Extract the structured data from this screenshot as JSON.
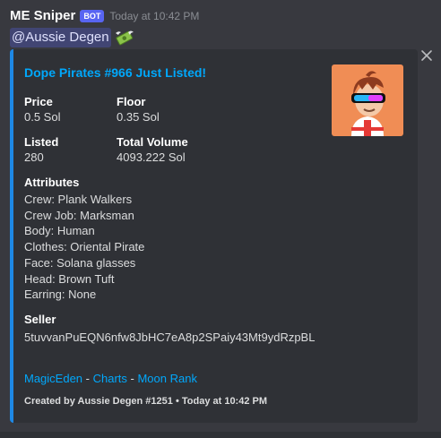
{
  "message": {
    "author": "ME Sniper",
    "bot_tag": "BOT",
    "timestamp": "Today at 10:42 PM",
    "mention": "@Aussie Degen",
    "reaction_icon": "money-with-wings-icon"
  },
  "embed": {
    "accent_color": "#1e88e5",
    "title": "Dope Pirates #966 Just Listed!",
    "thumbnail_icon": "pirate-avatar-icon",
    "fields": {
      "price": {
        "name": "Price",
        "value": "0.5 Sol"
      },
      "floor": {
        "name": "Floor",
        "value": "0.35 Sol"
      },
      "listed": {
        "name": "Listed",
        "value": "280"
      },
      "total_volume": {
        "name": "Total Volume",
        "value": "4093.222 Sol"
      },
      "seller": {
        "name": "Seller",
        "value": "5tuvvanPuEQN6nfw8JbHC7eA8p2SPaiy43Mt9ydRzpBL"
      }
    },
    "attributes_heading": "Attributes",
    "attributes": [
      "Crew: Plank Walkers",
      "Crew Job: Marksman",
      "Body: Human",
      "Clothes: Oriental Pirate",
      "Face: Solana glasses",
      "Head: Brown Tuft",
      "Earring: None"
    ],
    "links": [
      "MagicEden",
      "Charts",
      "Moon Rank"
    ],
    "link_separator": " - ",
    "footer": "Created by Aussie Degen #1251 • Today at 10:42 PM"
  }
}
